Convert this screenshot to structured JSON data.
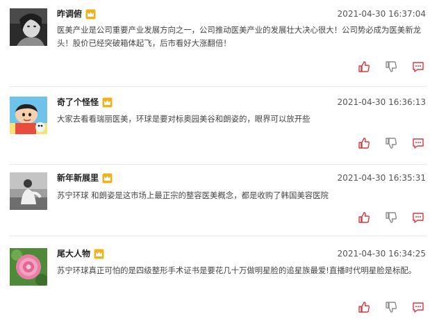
{
  "comments": [
    {
      "username": "昨调俯",
      "timestamp": "2021-04-30 16:37:04",
      "content": "医美产业是公司重要产业发展方向之一，公司推动医美产业的发展壮大决心很大！公司势必成为医美新龙头！股价已经突破箱体起飞，后市看好大涨翻倍！",
      "avatar": "portrait-woman-bw"
    },
    {
      "username": "奇了个怪怪",
      "timestamp": "2021-04-30 16:36:13",
      "content": "大家去看看瑞丽医美，环球是要对标奥园美谷和朗姿的，眼界可以放开些",
      "avatar": "cartoon-crayon-shinchan"
    },
    {
      "username": "新年新展里",
      "timestamp": "2021-04-30 16:35:31",
      "content": "苏宁环球 和朗姿是这市场上最正宗的整容医美概念，都是收购了韩国美容医院",
      "avatar": "person-sitting-bw"
    },
    {
      "username": "尾大人物",
      "timestamp": "2021-04-30 16:34:25",
      "content": "苏宁环球真正可怕的是四级整形手术证书是要花几十万做明星脸的追星族最爱!直播时代明星脸是标配。",
      "avatar": "pink-peony-flower"
    }
  ],
  "icons": {
    "vip_badge": "crown-icon",
    "like": "thumbs-up-icon",
    "dislike": "thumbs-down-icon",
    "reply": "comment-icon"
  },
  "colors": {
    "crown": "#f1b11b",
    "action_red": "#d9373b",
    "action_gray": "#8a8a8a",
    "divider": "#e6e6e6"
  }
}
